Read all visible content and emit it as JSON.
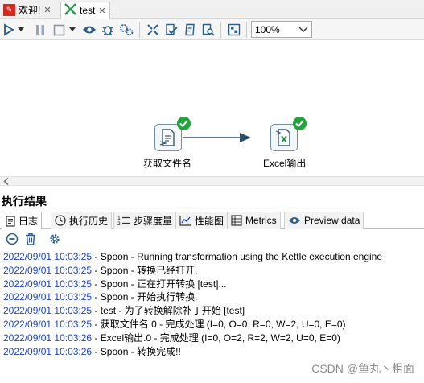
{
  "tabs": [
    {
      "label": "欢迎!",
      "close": "✕"
    },
    {
      "label": "test",
      "close": "✕"
    }
  ],
  "toolbar": {
    "zoom_value": "100%"
  },
  "canvas": {
    "step1_label": "获取文件名",
    "step2_label": "Excel输出"
  },
  "results": {
    "title": "执行结果",
    "tabs": [
      "日志",
      "执行历史",
      "步骤度量",
      "性能图",
      "Metrics",
      "Preview data"
    ]
  },
  "log": [
    {
      "time": "2022/09/01 10:03:25",
      "msg": " - Spoon - Running transformation using the Kettle execution engine"
    },
    {
      "time": "2022/09/01 10:03:25",
      "msg": " - Spoon - 转换已经打开."
    },
    {
      "time": "2022/09/01 10:03:25",
      "msg": " - Spoon - 正在打开转换 [test]..."
    },
    {
      "time": "2022/09/01 10:03:25",
      "msg": " - Spoon - 开始执行转换."
    },
    {
      "time": "2022/09/01 10:03:25",
      "msg": " - test - 为了转换解除补丁开始  [test]"
    },
    {
      "time": "2022/09/01 10:03:25",
      "msg": " - 获取文件名.0 - 完成处理 (I=0, O=0, R=0, W=2, U=0, E=0)"
    },
    {
      "time": "2022/09/01 10:03:26",
      "msg": " - Excel输出.0 - 完成处理 (I=0, O=2, R=2, W=2, U=0, E=0)"
    },
    {
      "time": "2022/09/01 10:03:26",
      "msg": " - Spoon - 转换完成!!"
    }
  ],
  "watermark": "CSDN @鱼丸丶粗面",
  "colors": {
    "timestamp": "#1a44c4",
    "success": "#23a33a",
    "hop": "#2d4f6b"
  }
}
